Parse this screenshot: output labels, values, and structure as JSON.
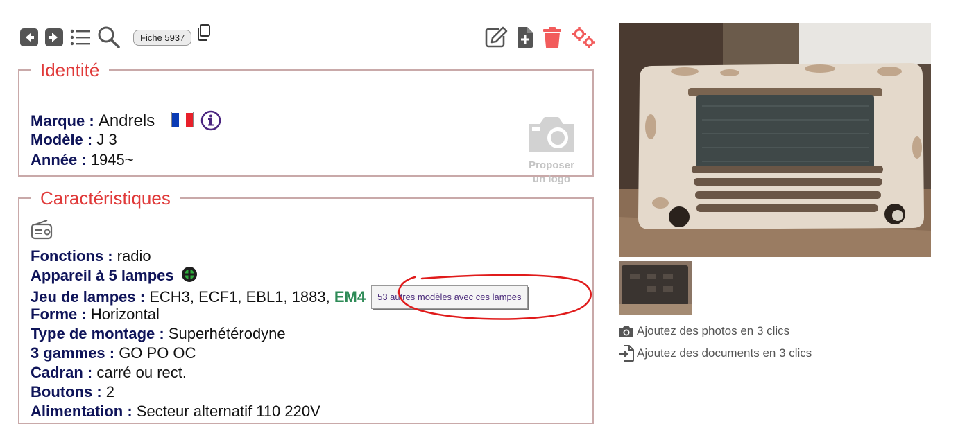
{
  "toolbar": {
    "fiche_label": "Fiche 5937"
  },
  "identite": {
    "title": "Identité",
    "marque_label": "Marque :",
    "marque_value": "Andrels",
    "modele_label": "Modèle :",
    "modele_value": "J 3",
    "annee_label": "Année :",
    "annee_value": "1945~",
    "logo_line1": "Proposer",
    "logo_line2": "un logo"
  },
  "caract": {
    "title": "Caractéristiques",
    "fonctions_label": "Fonctions :",
    "fonctions_value": "radio",
    "appareil_label": "Appareil à 5 lampes",
    "jeu_label": "Jeu de lampes :",
    "tubes": [
      "ECH3",
      "ECF1",
      "EBL1",
      "1883",
      "EM4"
    ],
    "tubes_tooltip": "53 autres modèles avec ces lampes",
    "forme_label": "Forme :",
    "forme_value": "Horizontal",
    "montage_label": "Type de montage :",
    "montage_value": "Superhétérodyne",
    "gammes_label": "3 gammes :",
    "gammes_value": "GO PO OC",
    "cadran_label": "Cadran :",
    "cadran_value": "carré ou rect.",
    "boutons_label": "Boutons :",
    "boutons_value": "2",
    "alim_label": "Alimentation :",
    "alim_value": "Secteur alternatif 110 220V"
  },
  "sidebar": {
    "add_photos": "Ajoutez des photos en 3 clics",
    "add_docs": "Ajoutez des documents en 3 clics"
  },
  "colors": {
    "legend": "#e03a3a",
    "label": "#0f1459",
    "border": "#c9a9a9",
    "em4": "#2e8b57",
    "delete": "#f25c5c",
    "annotation": "#e01b1b"
  },
  "icons": [
    "arrow-left-icon",
    "arrow-right-icon",
    "list-icon",
    "search-icon",
    "copy-icon",
    "edit-icon",
    "add-file-icon",
    "trash-icon",
    "gears-icon",
    "info-icon",
    "camera-icon",
    "radio-icon",
    "green-dot-icon",
    "file-import-icon"
  ]
}
